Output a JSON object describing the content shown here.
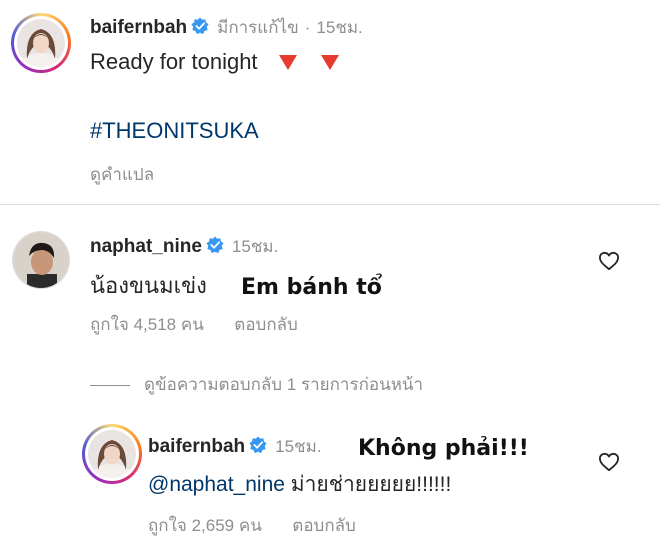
{
  "post": {
    "username": "baifernbah",
    "edited": "มีการแก้ไข",
    "separator": "·",
    "time": "15ชม.",
    "caption_text": "Ready for tonight",
    "hashtag": "#THEONITSUKA",
    "translate_label": "ดูคำแปล"
  },
  "comment1": {
    "username": "naphat_nine",
    "time": "15ชม.",
    "text": "น้องขนมเข่ง",
    "overlay_caption": "Em bánh tổ",
    "likes": "ถูกใจ 4,518 คน",
    "reply_label": "ตอบกลับ"
  },
  "view_replies_label": "ดูข้อความตอบกลับ 1 รายการก่อนหน้า",
  "reply1": {
    "username": "baifernbah",
    "time": "15ชม.",
    "overlay_caption": "Không phải!!!",
    "mention": "@naphat_nine",
    "text": "ม่ายช่ายยยยย!!!!!!",
    "likes": "ถูกใจ 2,659 คน",
    "reply_label": "ตอบกลับ"
  },
  "colors": {
    "verified_blue": "#3897f0",
    "link_blue": "#00376b",
    "meta_grey": "#8e8e8e",
    "heart_red": "#ed4956"
  },
  "icons": [
    "verified-badge-icon",
    "heart-outline-icon",
    "red-triangle-emoji"
  ]
}
